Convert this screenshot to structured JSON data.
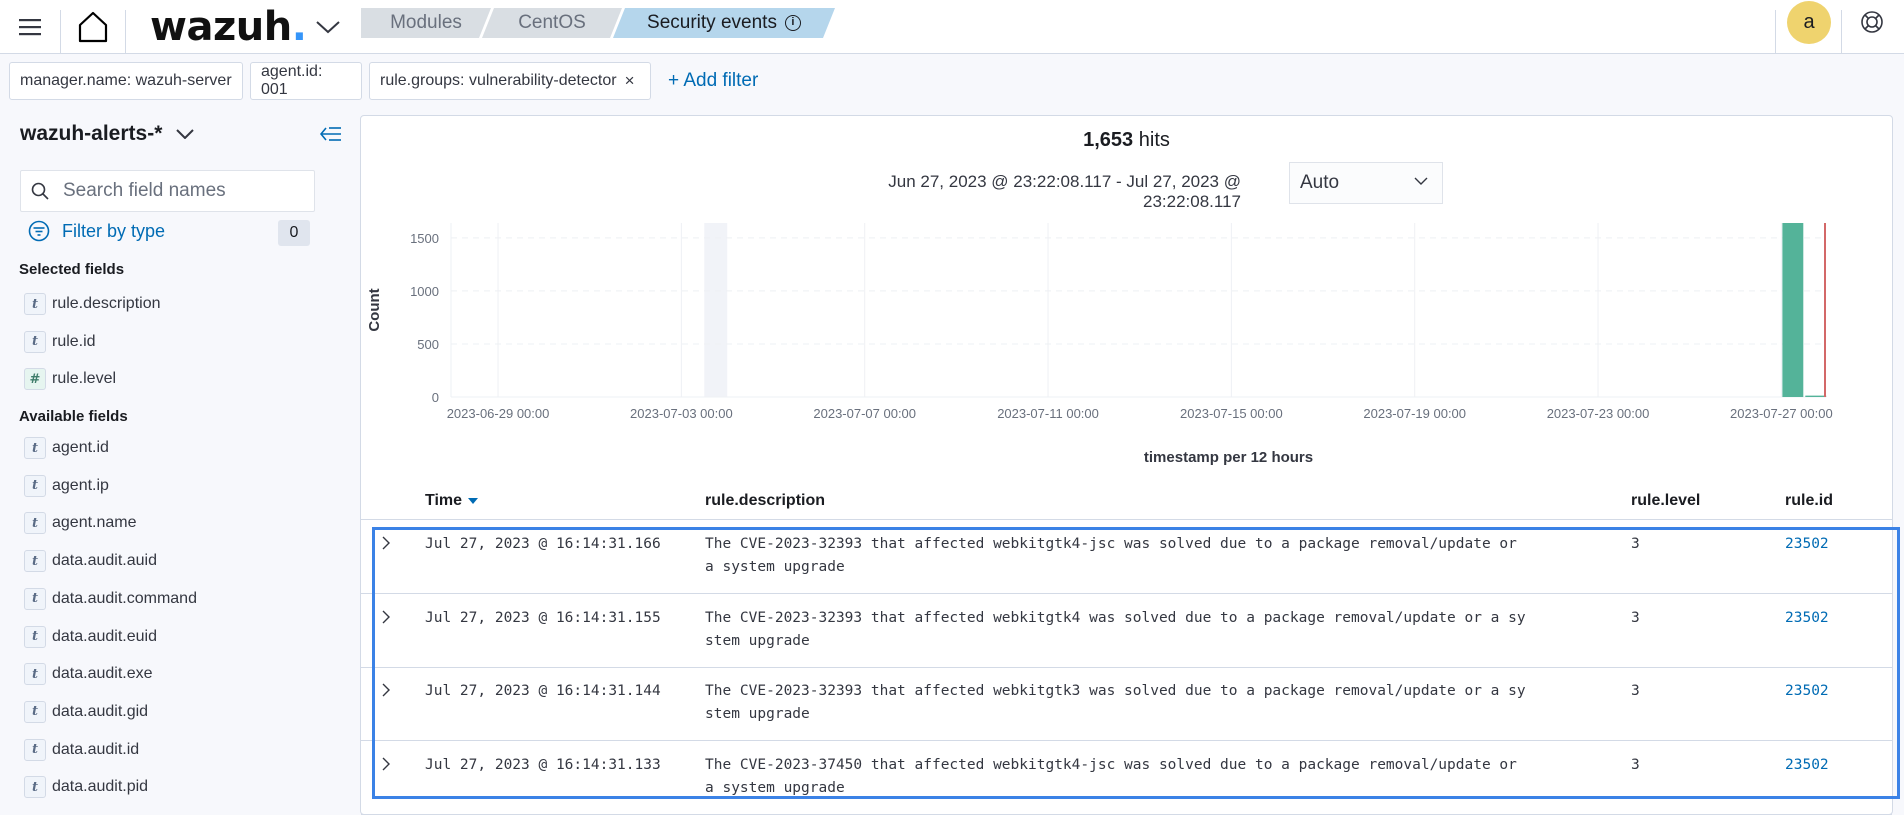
{
  "header": {
    "logo_text": "wazuh",
    "logo_dot": ".",
    "breadcrumbs": [
      "Modules",
      "CentOS",
      "Security events"
    ],
    "info_glyph": "i",
    "avatar_initial": "a",
    "icons": [
      "menu-icon",
      "home-icon",
      "chevron-down-icon",
      "info-icon",
      "help-icon"
    ]
  },
  "filters": {
    "pills": [
      {
        "label": "manager.name: wazuh-server",
        "removable": false
      },
      {
        "label": "agent.id: 001",
        "removable": false
      },
      {
        "label": "rule.groups: vulnerability-detector",
        "removable": true
      }
    ],
    "remove_glyph": "×",
    "add_label": "+ Add filter"
  },
  "sidebar": {
    "index_pattern": "wazuh-alerts-*",
    "search_placeholder": "Search field names",
    "filter_by_type_label": "Filter by type",
    "filter_count": "0",
    "selected_heading": "Selected fields",
    "selected_fields": [
      {
        "type": "t",
        "name": "rule.description"
      },
      {
        "type": "t",
        "name": "rule.id"
      },
      {
        "type": "#",
        "name": "rule.level"
      }
    ],
    "available_heading": "Available fields",
    "available_fields": [
      {
        "type": "t",
        "name": "agent.id"
      },
      {
        "type": "t",
        "name": "agent.ip"
      },
      {
        "type": "t",
        "name": "agent.name"
      },
      {
        "type": "t",
        "name": "data.audit.auid"
      },
      {
        "type": "t",
        "name": "data.audit.command"
      },
      {
        "type": "t",
        "name": "data.audit.euid"
      },
      {
        "type": "t",
        "name": "data.audit.exe"
      },
      {
        "type": "t",
        "name": "data.audit.gid"
      },
      {
        "type": "t",
        "name": "data.audit.id"
      },
      {
        "type": "t",
        "name": "data.audit.pid"
      }
    ]
  },
  "main": {
    "hits_count": "1,653",
    "hits_label": "hits",
    "time_range": "Jun 27, 2023 @ 23:22:08.117 - Jul 27, 2023 @ 23:22:08.117",
    "interval": "Auto",
    "table": {
      "columns": [
        "Time",
        "rule.description",
        "rule.level",
        "rule.id"
      ],
      "rows": [
        {
          "time": "Jul 27, 2023 @ 16:14:31.166",
          "desc_line1": "The CVE-2023-32393 that affected webkitgtk4-jsc was solved due to a package removal/update or",
          "desc_line2": "a system upgrade",
          "level": "3",
          "id": "23502"
        },
        {
          "time": "Jul 27, 2023 @ 16:14:31.155",
          "desc_line1": "The CVE-2023-32393 that affected webkitgtk4 was solved due to a package removal/update or a sy",
          "desc_line2": "stem upgrade",
          "level": "3",
          "id": "23502"
        },
        {
          "time": "Jul 27, 2023 @ 16:14:31.144",
          "desc_line1": "The CVE-2023-32393 that affected webkitgtk3 was solved due to a package removal/update or a sy",
          "desc_line2": "stem upgrade",
          "level": "3",
          "id": "23502"
        },
        {
          "time": "Jul 27, 2023 @ 16:14:31.133",
          "desc_line1": "The CVE-2023-37450 that affected webkitgtk4-jsc was solved due to a package removal/update or",
          "desc_line2": "a system upgrade",
          "level": "3",
          "id": "23502"
        }
      ]
    }
  },
  "colors": {
    "bar": "#54b399",
    "now_marker": "#d36868",
    "selection": "#3b82e6",
    "link": "#006bb4",
    "avatar": "#efd36e",
    "breadcrumb_active": "#b5d6ec"
  },
  "chart_data": {
    "type": "bar",
    "title": "",
    "xlabel": "timestamp per 12 hours",
    "ylabel": "Count",
    "ylim": [
      0,
      1640
    ],
    "yticks": [
      0,
      500,
      1000,
      1500
    ],
    "xticks": [
      "2023-06-29 00:00",
      "2023-07-03 00:00",
      "2023-07-07 00:00",
      "2023-07-11 00:00",
      "2023-07-15 00:00",
      "2023-07-19 00:00",
      "2023-07-23 00:00",
      "2023-07-27 00:00"
    ],
    "x_range_days": [
      "2023-06-27 23:22",
      "2023-07-27 23:22"
    ],
    "interval_hours": 12,
    "bars": [
      {
        "start": "2023-07-27 00:00",
        "value": 1640
      },
      {
        "start": "2023-07-27 12:00",
        "value": 13
      }
    ],
    "highlight_band": {
      "start": "2023-07-03 12:00",
      "end": "2023-07-04 00:00"
    },
    "now_marker": "2023-07-27 23:22",
    "grid": true,
    "legend": "none"
  }
}
